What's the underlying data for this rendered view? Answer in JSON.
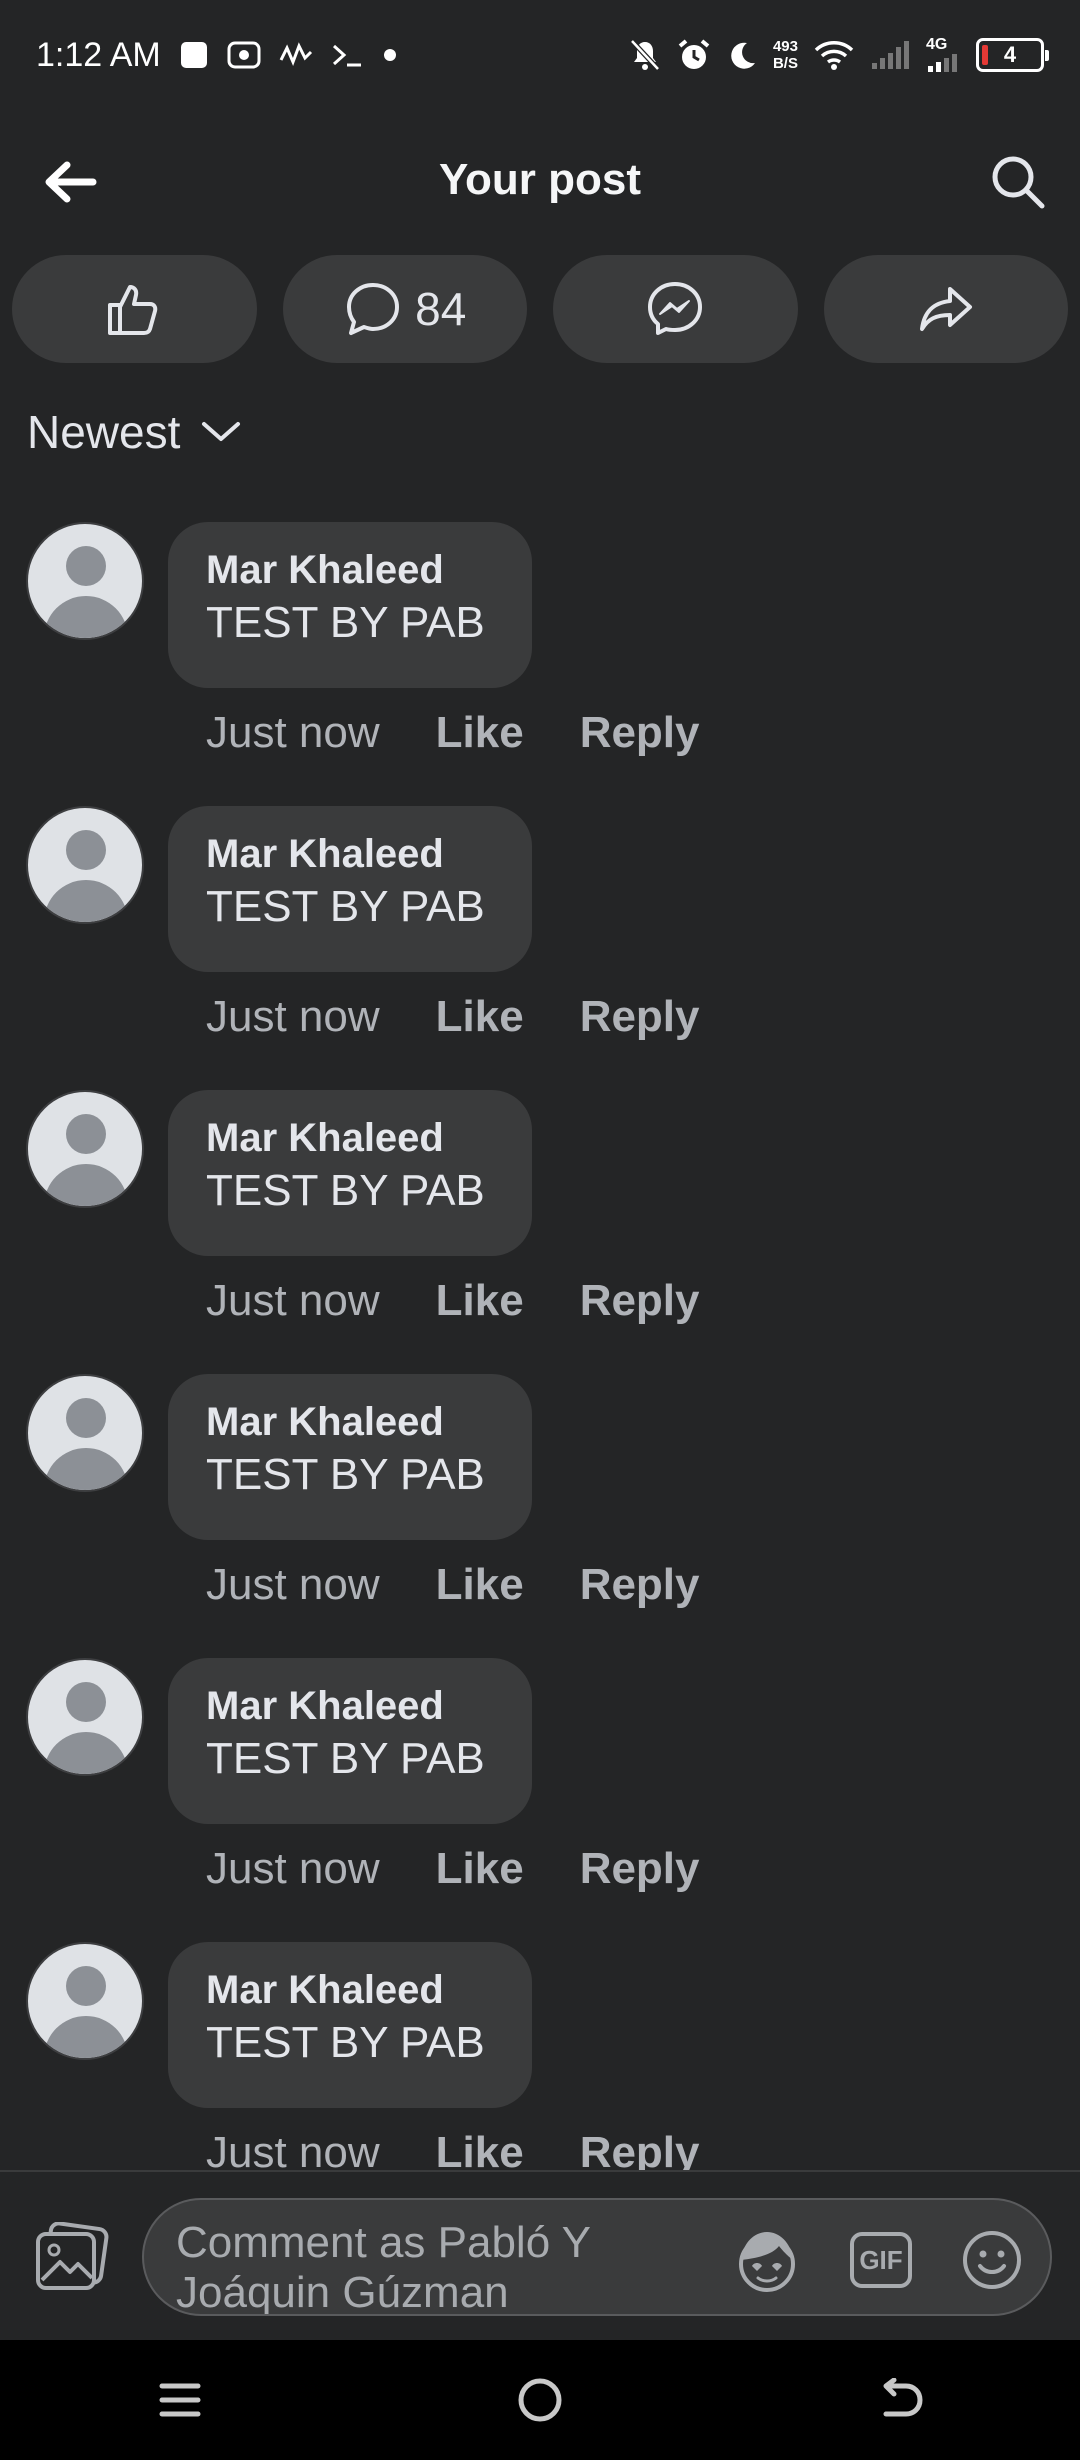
{
  "status_bar": {
    "time": "1:12 AM",
    "net_speed_value": "493",
    "net_speed_unit": "B/S",
    "network_type": "4G",
    "battery_level": "4",
    "icons": [
      "notification-square-icon",
      "media-icon",
      "chart-icon",
      "terminal-icon",
      "dot-icon",
      "mute-icon",
      "alarm-icon",
      "moon-icon",
      "wifi-icon",
      "signal-icon",
      "battery-icon"
    ]
  },
  "header": {
    "title": "Your post",
    "back_icon": "arrow-left-icon",
    "search_icon": "search-icon"
  },
  "actions": {
    "like_icon": "thumbs-up-icon",
    "comment_icon": "comment-icon",
    "comment_count": "84",
    "messenger_icon": "messenger-icon",
    "share_icon": "share-icon"
  },
  "sort": {
    "label": "Newest",
    "icon": "chevron-down-icon"
  },
  "comments": [
    {
      "author": "Mar Khaleed",
      "text": "TEST BY PAB",
      "time": "Just now",
      "like_label": "Like",
      "reply_label": "Reply"
    },
    {
      "author": "Mar Khaleed",
      "text": "TEST BY PAB",
      "time": "Just now",
      "like_label": "Like",
      "reply_label": "Reply"
    },
    {
      "author": "Mar Khaleed",
      "text": "TEST BY PAB",
      "time": "Just now",
      "like_label": "Like",
      "reply_label": "Reply"
    },
    {
      "author": "Mar Khaleed",
      "text": "TEST BY PAB",
      "time": "Just now",
      "like_label": "Like",
      "reply_label": "Reply"
    },
    {
      "author": "Mar Khaleed",
      "text": "TEST BY PAB",
      "time": "Just now",
      "like_label": "Like",
      "reply_label": "Reply"
    },
    {
      "author": "Mar Khaleed",
      "text": "TEST BY PAB",
      "time": "Just now",
      "like_label": "Like",
      "reply_label": "Reply"
    }
  ],
  "composer": {
    "placeholder": "Comment as Pabló Y Joáquin Gúzman",
    "gallery_icon": "gallery-icon",
    "avatar_sticker_icon": "avatar-sticker-icon",
    "gif_label": "GIF",
    "emoji_icon": "emoji-icon"
  },
  "navigation": {
    "icons": [
      "menu-icon",
      "home-icon",
      "back-icon"
    ]
  },
  "colors": {
    "background": "#242526",
    "surface": "#3a3b3c",
    "text_primary": "#e4e6eb",
    "text_secondary": "#b0b3b8",
    "battery_low": "#e53935"
  }
}
